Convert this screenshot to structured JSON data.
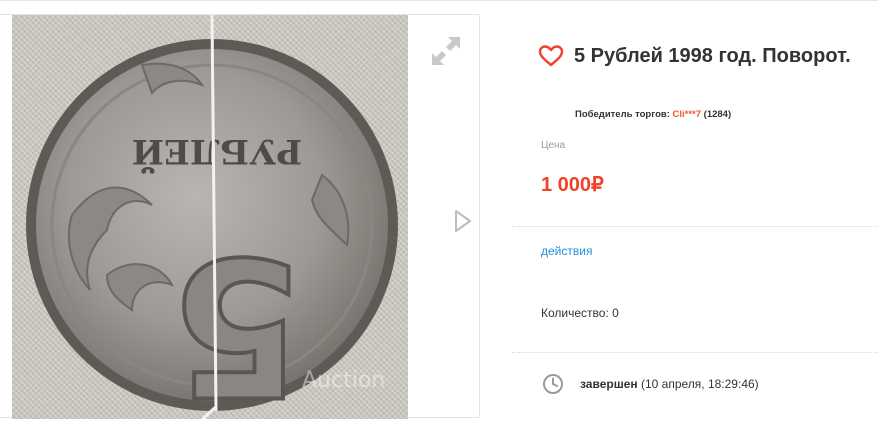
{
  "gallery": {
    "expand_icon": "expand-arrows-icon",
    "next_icon": "triangle-right-icon",
    "coin_text": "РУБЛЕЙ",
    "coin_digit": "5",
    "watermark": "Auction"
  },
  "lot": {
    "title": "5 Рублей 1998 год. Поворот.",
    "winner_label": "Победитель торгов:",
    "winner_user": "Cli***7",
    "winner_rating": "(1284)",
    "price_label": "Цена",
    "price": "1 000₽",
    "actions_label": "действия",
    "quantity": "Количество: 0",
    "status": "завершен",
    "status_time": "(10 апреля, 18:29:46)"
  },
  "colors": {
    "accent": "#f0412a",
    "user_link": "#f05a28",
    "link": "#2a8fd6"
  }
}
